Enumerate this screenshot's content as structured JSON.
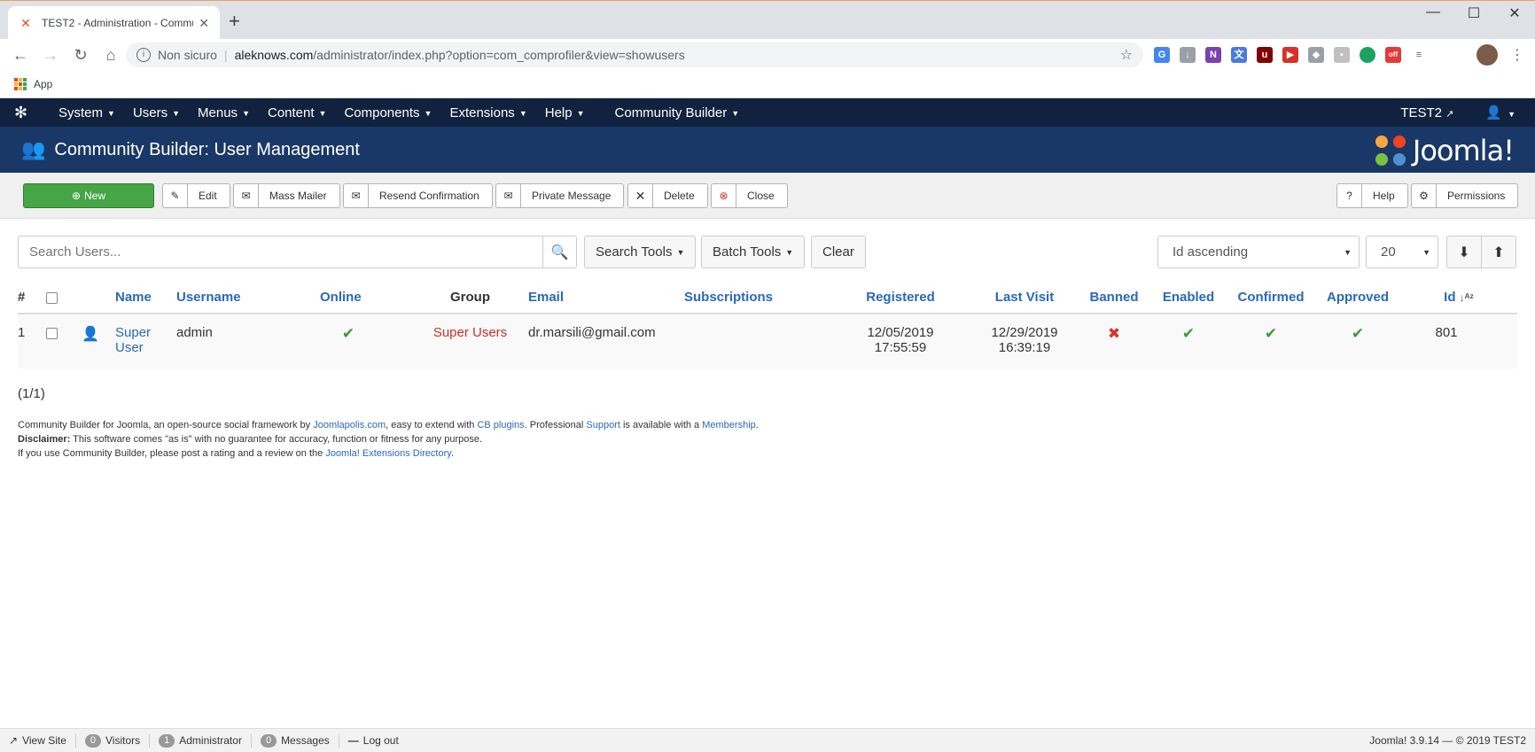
{
  "browser": {
    "tab_title": "TEST2 - Administration - Commu",
    "url_security": "Non sicuro",
    "url_host": "aleknows.com",
    "url_path": "/administrator/index.php?option=com_comprofiler&view=showusers",
    "bookmark_apps": "App"
  },
  "nav": {
    "menus": [
      {
        "label": "System"
      },
      {
        "label": "Users"
      },
      {
        "label": "Menus"
      },
      {
        "label": "Content"
      },
      {
        "label": "Components"
      },
      {
        "label": "Extensions"
      },
      {
        "label": "Help"
      },
      {
        "label": "Community Builder"
      }
    ],
    "site_name": "TEST2"
  },
  "header": {
    "title": "Community Builder: User Management",
    "brand": "Joomla!"
  },
  "toolbar": {
    "new": "New",
    "edit": "Edit",
    "mass_mailer": "Mass Mailer",
    "resend": "Resend Confirmation",
    "pm": "Private Message",
    "delete": "Delete",
    "close": "Close",
    "help": "Help",
    "permissions": "Permissions"
  },
  "filters": {
    "search_placeholder": "Search Users...",
    "search_tools": "Search Tools",
    "batch_tools": "Batch Tools",
    "clear": "Clear",
    "ordering": "Id ascending",
    "limit": "20"
  },
  "table": {
    "headers": {
      "num": "#",
      "name": "Name",
      "username": "Username",
      "online": "Online",
      "group": "Group",
      "email": "Email",
      "subscriptions": "Subscriptions",
      "registered": "Registered",
      "last_visit": "Last Visit",
      "banned": "Banned",
      "enabled": "Enabled",
      "confirmed": "Confirmed",
      "approved": "Approved",
      "id": "Id"
    },
    "rows": [
      {
        "num": "1",
        "name_line1": "Super",
        "name_line2": "User",
        "username": "admin",
        "group": "Super Users",
        "email": "dr.marsili@gmail.com",
        "registered_date": "12/05/2019",
        "registered_time": "17:55:59",
        "last_visit_date": "12/29/2019",
        "last_visit_time": "16:39:19",
        "id": "801"
      }
    ]
  },
  "pager": "(1/1)",
  "footer": {
    "l1_a": "Community Builder for Joomla, an open-source social framework by ",
    "l1_link1": "Joomlapolis.com",
    "l1_b": ", easy to extend with ",
    "l1_link2": "CB plugins",
    "l1_c": ". Professional ",
    "l1_link3": "Support",
    "l1_d": " is available with a ",
    "l1_link4": "Membership",
    "l1_e": ".",
    "l2_bold": "Disclaimer:",
    "l2_text": " This software comes \"as is\" with no guarantee for accuracy, function or fitness for any purpose.",
    "l3_a": "If you use Community Builder, please post a rating and a review on the ",
    "l3_link": "Joomla! Extensions Directory",
    "l3_b": "."
  },
  "status": {
    "view_site": "View Site",
    "visitors_count": "0",
    "visitors": "Visitors",
    "admin_count": "1",
    "admin": "Administrator",
    "messages_count": "0",
    "messages": "Messages",
    "logout": "Log out",
    "version": "Joomla! 3.9.14 — © 2019 TEST2"
  },
  "colors": {
    "nav_bg": "#10223e",
    "header_bg": "#1a3867",
    "new_button": "#46a546",
    "link": "#2a69b8"
  }
}
